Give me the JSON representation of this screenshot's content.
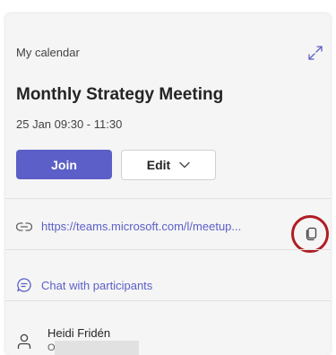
{
  "header": {
    "calendar_label": "My calendar",
    "expand_icon": "expand-diagonal-icon"
  },
  "meeting": {
    "title": "Monthly Strategy Meeting",
    "time": "25 Jan 09:30 - 11:30"
  },
  "actions": {
    "join_label": "Join",
    "edit_label": "Edit",
    "edit_icon": "chevron-down-icon"
  },
  "link": {
    "icon": "link-icon",
    "text": "https://teams.microsoft.com/l/meetup...",
    "copy_icon": "copy-icon"
  },
  "chat": {
    "icon": "chat-icon",
    "label": "Chat with participants"
  },
  "participant": {
    "icon": "person-icon",
    "name": "Heidi Fridén",
    "subtitle": "O"
  },
  "colors": {
    "accent": "#5b5fc7",
    "highlight": "#b01e23",
    "card_bg": "#f5f5f5"
  }
}
